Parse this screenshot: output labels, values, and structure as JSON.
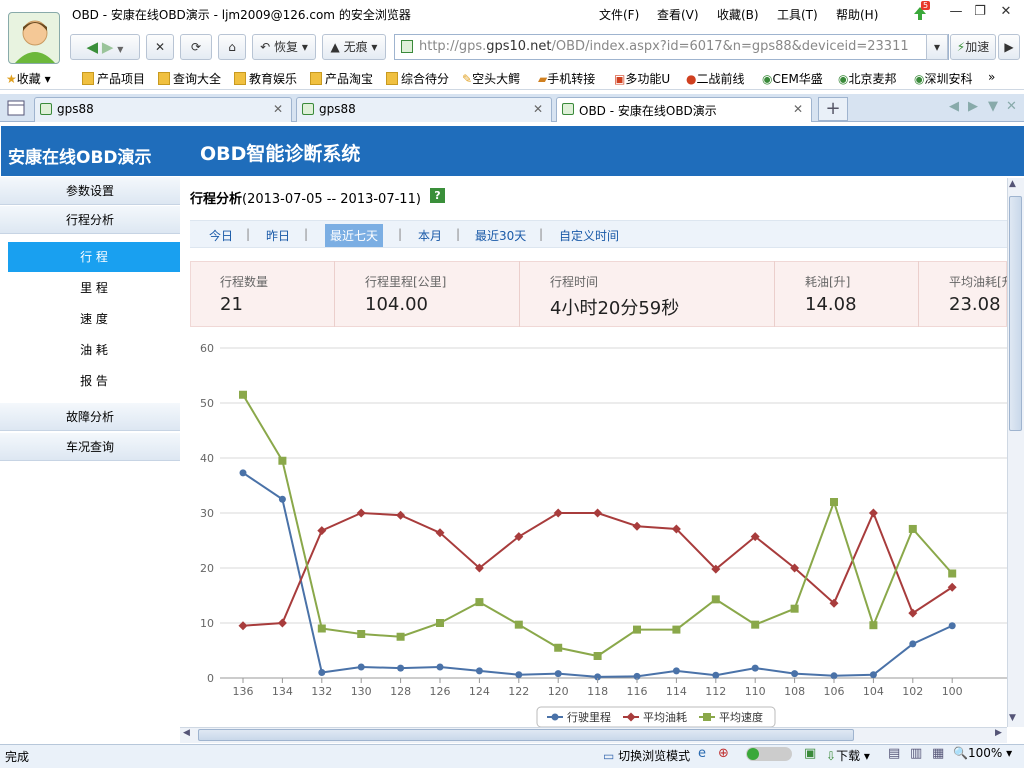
{
  "window": {
    "title": "OBD - 安康在线OBD演示 - ljm2009@126.com 的安全浏览器",
    "menu": [
      "文件(F)",
      "查看(V)",
      "收藏(B)",
      "工具(T)",
      "帮助(H)"
    ],
    "badge": "5"
  },
  "nav": {
    "restore": "恢复",
    "notrace": "无痕",
    "url_prefix": "http://gps.",
    "url_domain": "gps10.net",
    "url_rest": "/OBD/index.aspx?id=6017&n=gps88&deviceid=23311",
    "accelerate": "加速"
  },
  "favorites": [
    "收藏",
    "产品项目",
    "查询大全",
    "教育娱乐",
    "产品淘宝",
    "综合待分",
    "空头大鳄",
    "手机转接",
    "多功能U",
    "二战前线",
    "CEM华盛",
    "北京麦邦",
    "深圳安科",
    "»"
  ],
  "tabs": [
    {
      "label": "gps88",
      "active": false
    },
    {
      "label": "gps88",
      "active": false
    },
    {
      "label": "OBD - 安康在线OBD演示",
      "active": true
    }
  ],
  "page": {
    "app_title": "安康在线OBD演示",
    "system_title": "OBD智能诊断系统",
    "sidebar": {
      "param": "参数设置",
      "trip": "行程分析",
      "sub": [
        "行 程",
        "里 程",
        "速 度",
        "油 耗",
        "报 告"
      ],
      "fault": "故障分析",
      "vehicle": "车况查询"
    },
    "section_title": "行程分析",
    "date_range": "(2013-07-05 -- 2013-07-11)",
    "help": "?",
    "ranges": [
      "今日",
      "昨日",
      "最近七天",
      "本月",
      "最近30天",
      "自定义时间"
    ],
    "active_range": "最近七天",
    "stats": [
      {
        "label": "行程数量",
        "value": "21"
      },
      {
        "label": "行程里程[公里]",
        "value": "104.00"
      },
      {
        "label": "行程时间",
        "value": "4小时20分59秒"
      },
      {
        "label": "耗油[升]",
        "value": "14.08"
      },
      {
        "label": "平均油耗[升",
        "value": "23.08"
      }
    ]
  },
  "chart_data": {
    "type": "line",
    "x": [
      "136",
      "134",
      "132",
      "130",
      "128",
      "126",
      "124",
      "122",
      "120",
      "118",
      "116",
      "114",
      "112",
      "110",
      "108",
      "106",
      "104",
      "102",
      "100"
    ],
    "ylim": [
      0,
      60
    ],
    "yticks": [
      0,
      10,
      20,
      30,
      40,
      50,
      60
    ],
    "grid": true,
    "legend": "bottom",
    "series": [
      {
        "name": "行驶里程",
        "color": "#4a72a8",
        "marker": "circle",
        "values": [
          37.3,
          32.5,
          1.0,
          2.0,
          1.8,
          2.0,
          1.3,
          0.6,
          0.8,
          0.2,
          0.3,
          1.3,
          0.5,
          1.8,
          0.8,
          0.4,
          0.6,
          6.2,
          9.5
        ]
      },
      {
        "name": "平均油耗",
        "color": "#a83c3c",
        "marker": "diamond",
        "values": [
          9.5,
          10.0,
          26.8,
          30.0,
          29.6,
          26.4,
          20.0,
          25.7,
          30.0,
          30.0,
          27.6,
          27.1,
          19.8,
          25.7,
          20.0,
          13.6,
          30.0,
          11.8,
          16.5
        ]
      },
      {
        "name": "平均速度",
        "color": "#8aa84a",
        "marker": "square",
        "values": [
          51.5,
          39.5,
          9.0,
          8.0,
          7.5,
          10.0,
          13.8,
          9.7,
          5.5,
          4.0,
          8.8,
          8.8,
          14.3,
          9.7,
          12.6,
          32.0,
          9.6,
          27.1,
          19.0
        ]
      }
    ]
  },
  "status": {
    "left": "完成",
    "mode": "切换浏览模式",
    "download": "下载",
    "zoom": "100%"
  }
}
